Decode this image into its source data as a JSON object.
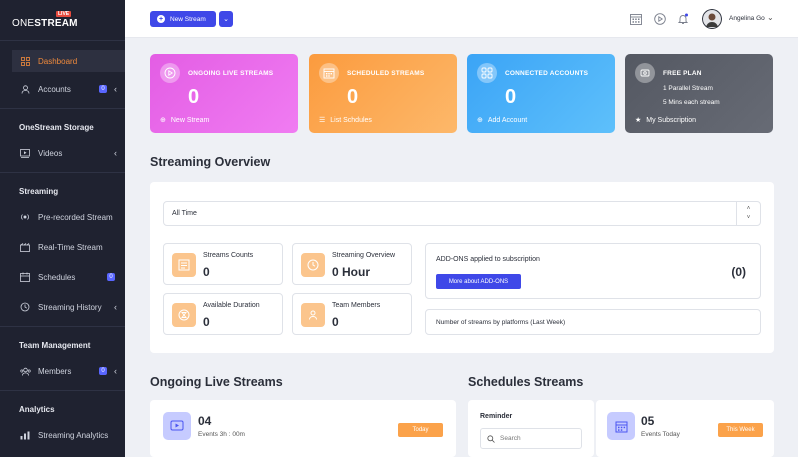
{
  "brand": {
    "name_thin": "ONE",
    "name_bold": "STREAM",
    "live_tag": "LIVE"
  },
  "sidebar": {
    "items": [
      {
        "label": "Dashboard"
      },
      {
        "label": "Accounts",
        "badge": "0"
      },
      {
        "label": "Videos"
      },
      {
        "label": "Pre-recorded Stream"
      },
      {
        "label": "Real-Time Stream"
      },
      {
        "label": "Schedules",
        "badge": "0"
      },
      {
        "label": "Streaming History"
      },
      {
        "label": "Members",
        "badge": "0"
      },
      {
        "label": "Streaming Analytics"
      }
    ],
    "sections": {
      "storage": "OneStream Storage",
      "streaming": "Streaming",
      "team": "Team Management",
      "analytics": "Analytics"
    }
  },
  "topbar": {
    "new_stream_label": "New Stream",
    "user_name": "Angelina Go"
  },
  "cards": {
    "ongoing": {
      "title": "ONGOING LIVE STREAMS",
      "value": "0",
      "footer": "New Stream"
    },
    "scheduled": {
      "title": "SCHEDULED STREAMS",
      "value": "0",
      "footer": "List Schdules"
    },
    "connected": {
      "title": "CONNECTED ACCOUNTS",
      "value": "0",
      "footer": "Add Account"
    },
    "plan": {
      "title": "FREE PLAN",
      "line1": "1 Parallel Stream",
      "line2": "5 Mins each stream",
      "footer": "My Subscription"
    }
  },
  "overview": {
    "title": "Streaming Overview",
    "range": "All Time",
    "stats": {
      "counts": {
        "label": "Streams Counts",
        "value": "0"
      },
      "overview": {
        "label": "Streaming Overview",
        "value": "0 Hour"
      },
      "duration": {
        "label": "Available Duration",
        "value": "0"
      },
      "members": {
        "label": "Team Members",
        "value": "0"
      }
    },
    "addons": {
      "title": "ADD-ONS applied to subscription",
      "button": "More about ADD-ONS",
      "count": "(0)"
    },
    "platforms": "Number of streams by platforms (Last Week)"
  },
  "ongoing_section": {
    "title": "Ongoing Live Streams",
    "count": "04",
    "sub": "Events  3h : 00m",
    "tag": "Today"
  },
  "schedules_section": {
    "title": "Schedules Streams",
    "reminder": "Reminder",
    "search_placeholder": "Search",
    "count": "05",
    "sub": "Events Today",
    "tag": "This Week"
  },
  "colors": {
    "sidebar_bg": "#1f2230",
    "accent": "#3f48e8",
    "active_text": "#f08a3c",
    "card_ongoing": "#e45ce6",
    "card_scheduled": "#fb9d43",
    "card_connected": "#3aa7f5",
    "card_plan": "#585c66"
  }
}
